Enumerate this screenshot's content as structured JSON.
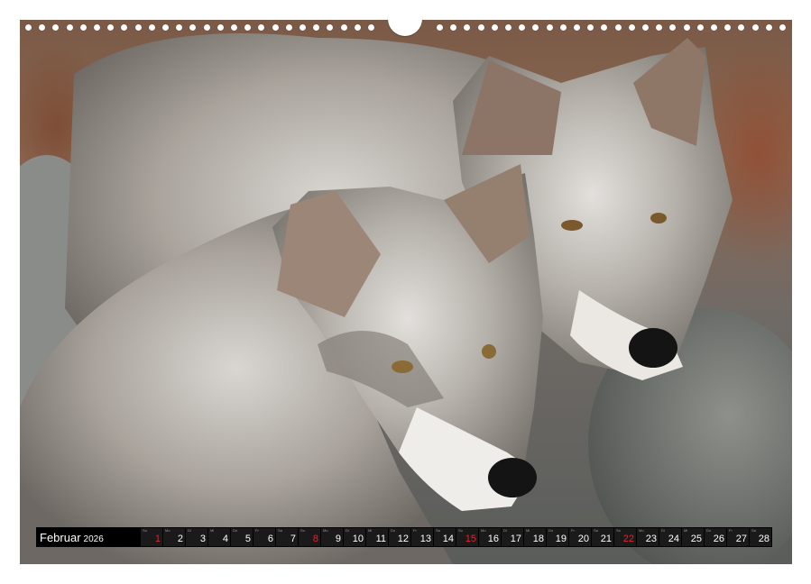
{
  "calendar": {
    "month": "Februar",
    "year": "2026",
    "days": [
      {
        "dn": "So",
        "num": "1",
        "red": true
      },
      {
        "dn": "Mo",
        "num": "2",
        "red": false
      },
      {
        "dn": "Di",
        "num": "3",
        "red": false
      },
      {
        "dn": "Mi",
        "num": "4",
        "red": false
      },
      {
        "dn": "Do",
        "num": "5",
        "red": false
      },
      {
        "dn": "Fr",
        "num": "6",
        "red": false
      },
      {
        "dn": "Sa",
        "num": "7",
        "red": false
      },
      {
        "dn": "So",
        "num": "8",
        "red": true
      },
      {
        "dn": "Mo",
        "num": "9",
        "red": false
      },
      {
        "dn": "Di",
        "num": "10",
        "red": false
      },
      {
        "dn": "Mi",
        "num": "11",
        "red": false
      },
      {
        "dn": "Do",
        "num": "12",
        "red": false
      },
      {
        "dn": "Fr",
        "num": "13",
        "red": false
      },
      {
        "dn": "Sa",
        "num": "14",
        "red": false
      },
      {
        "dn": "So",
        "num": "15",
        "red": true
      },
      {
        "dn": "Mo",
        "num": "16",
        "red": false
      },
      {
        "dn": "Di",
        "num": "17",
        "red": false
      },
      {
        "dn": "Mi",
        "num": "18",
        "red": false
      },
      {
        "dn": "Do",
        "num": "19",
        "red": false
      },
      {
        "dn": "Fr",
        "num": "20",
        "red": false
      },
      {
        "dn": "Sa",
        "num": "21",
        "red": false
      },
      {
        "dn": "So",
        "num": "22",
        "red": true
      },
      {
        "dn": "Mo",
        "num": "23",
        "red": false
      },
      {
        "dn": "Di",
        "num": "24",
        "red": false
      },
      {
        "dn": "Mi",
        "num": "25",
        "red": false
      },
      {
        "dn": "Do",
        "num": "26",
        "red": false
      },
      {
        "dn": "Fr",
        "num": "27",
        "red": false
      },
      {
        "dn": "Sa",
        "num": "28",
        "red": false
      }
    ]
  },
  "colors": {
    "weekday_text": "#ffffff",
    "sunday_text": "#e8202a",
    "bar_background": "#000000"
  }
}
